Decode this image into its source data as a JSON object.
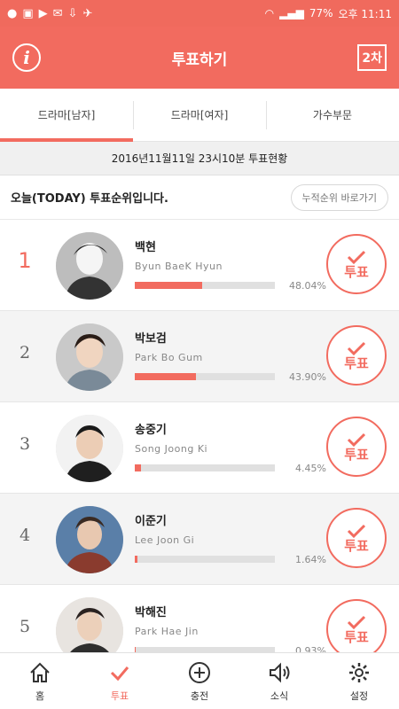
{
  "status_bar": {
    "battery": "77%",
    "time": "오후 11:11"
  },
  "header": {
    "title": "투표하기",
    "info_icon": "info-icon",
    "round_label": "2차"
  },
  "tabs": [
    {
      "label": "드라마[남자]",
      "active": true
    },
    {
      "label": "드라마[여자]",
      "active": false
    },
    {
      "label": "가수부문",
      "active": false
    }
  ],
  "time_bar": "2016년11월11일 23시10분 투표현황",
  "ranking": {
    "title": "오늘(TODAY) 투표순위입니다.",
    "cumulative_button": "누적순위 바로가기"
  },
  "vote_label": "투표",
  "candidates": [
    {
      "rank": "1",
      "name_ko": "백현",
      "name_en": "Byun BaeK Hyun",
      "percent": "48.04%",
      "fraction": 0.4804
    },
    {
      "rank": "2",
      "name_ko": "박보검",
      "name_en": "Park Bo Gum",
      "percent": "43.90%",
      "fraction": 0.439
    },
    {
      "rank": "3",
      "name_ko": "송중기",
      "name_en": "Song Joong Ki",
      "percent": "4.45%",
      "fraction": 0.0445
    },
    {
      "rank": "4",
      "name_ko": "이준기",
      "name_en": "Lee Joon Gi",
      "percent": "1.64%",
      "fraction": 0.0164
    },
    {
      "rank": "5",
      "name_ko": "박해진",
      "name_en": "Park Hae Jin",
      "percent": "0.93%",
      "fraction": 0.0093
    }
  ],
  "bottom_nav": [
    {
      "label": "홈",
      "icon": "home-icon",
      "active": false
    },
    {
      "label": "투표",
      "icon": "check-icon",
      "active": true
    },
    {
      "label": "충전",
      "icon": "plus-circle-icon",
      "active": false
    },
    {
      "label": "소식",
      "icon": "speaker-icon",
      "active": false
    },
    {
      "label": "설정",
      "icon": "gear-icon",
      "active": false
    }
  ],
  "colors": {
    "accent": "#f26b5f",
    "bar_track": "#e0e0e0"
  }
}
